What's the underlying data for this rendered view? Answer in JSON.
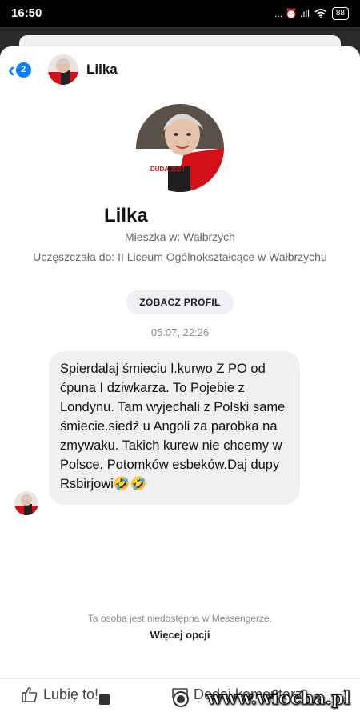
{
  "status_bar": {
    "time": "16:50",
    "signal_icons": "... ⏰ .ıll",
    "battery": "88"
  },
  "header": {
    "back_badge": "2",
    "name": "Lilka"
  },
  "profile": {
    "avatar_text": "DUDA 2020",
    "name": "Lilka",
    "lives_in": "Mieszka w: Wałbrzych",
    "school": "Uczęszczała do: II Liceum Ogólnokształcące w Wałbrzychu",
    "view_profile_label": "ZOBACZ PROFIL"
  },
  "conversation": {
    "timestamp": "05.07, 22:26",
    "message": "Spierdalaj śmieciu l.kurwo Z PO od ćpuna I dziwkarza. To Pojebie z Londynu. Tam wyjechali z Polski same śmiecie.siedź u Angoli za parobka na zmywaku. Takich kurew nie chcemy w Polsce. Potomków esbeków.Daj dupy Rsbirjowi🤣🤣"
  },
  "footer": {
    "unavailable_text": "Ta osoba jest niedostępna w Messengerze.",
    "more_options_label": "Więcej opcji"
  },
  "actions": {
    "like_label": "Lubię to!",
    "comment_label": "Dodaj komentarz"
  },
  "watermark": "www.wiocha.pl",
  "colors": {
    "accent": "#0a7cff",
    "bubble": "#f0f0f2"
  }
}
